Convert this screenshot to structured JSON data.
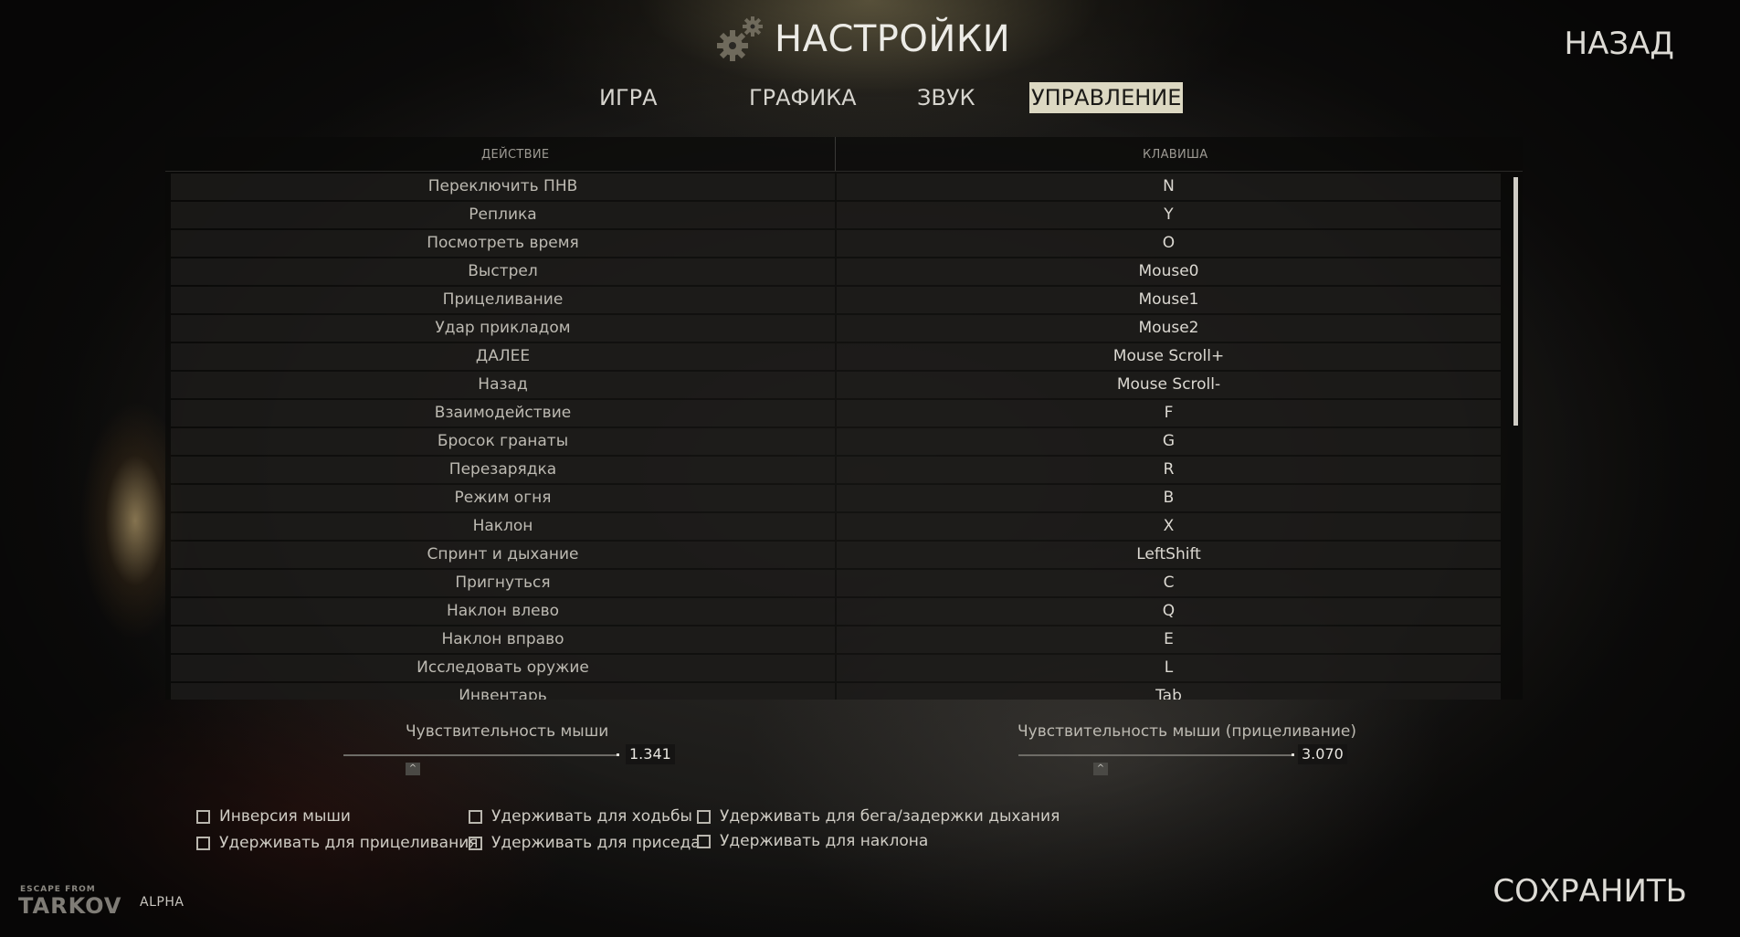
{
  "header": {
    "title": "НАСТРОЙКИ",
    "back_label": "НАЗАД"
  },
  "tabs": [
    {
      "label": "ИГРА",
      "active": false
    },
    {
      "label": "ГРАФИКА",
      "active": false
    },
    {
      "label": "ЗВУК",
      "active": false
    },
    {
      "label": "УПРАВЛЕНИЕ",
      "active": true
    }
  ],
  "table": {
    "columns": [
      "ДЕЙСТВИЕ",
      "КЛАВИША"
    ],
    "rows": [
      {
        "action": "Переключить ПНВ",
        "key": "N"
      },
      {
        "action": "Реплика",
        "key": "Y"
      },
      {
        "action": "Посмотреть время",
        "key": "O"
      },
      {
        "action": "Выстрел",
        "key": "Mouse0"
      },
      {
        "action": "Прицеливание",
        "key": "Mouse1"
      },
      {
        "action": "Удар прикладом",
        "key": "Mouse2"
      },
      {
        "action": "ДАЛЕЕ",
        "key": "Mouse Scroll+"
      },
      {
        "action": "Назад",
        "key": "Mouse Scroll-"
      },
      {
        "action": "Взаимодействие",
        "key": "F"
      },
      {
        "action": "Бросок гранаты",
        "key": "G"
      },
      {
        "action": "Перезарядка",
        "key": "R"
      },
      {
        "action": "Режим огня",
        "key": "B"
      },
      {
        "action": "Наклон",
        "key": "X"
      },
      {
        "action": "Спринт и дыхание",
        "key": "LeftShift"
      },
      {
        "action": "Пригнуться",
        "key": "C"
      },
      {
        "action": "Наклон влево",
        "key": "Q"
      },
      {
        "action": "Наклон вправо",
        "key": "E"
      },
      {
        "action": "Исследовать оружие",
        "key": "L"
      },
      {
        "action": "Инвентарь",
        "key": "Tab"
      }
    ]
  },
  "sliders": {
    "mouse_sensitivity": {
      "label": "Чувствительность мыши",
      "value": "1.341"
    },
    "aim_sensitivity": {
      "label": "Чувствительность мыши (прицеливание)",
      "value": "3.070"
    },
    "handle_glyph": "^"
  },
  "checkboxes": [
    {
      "label": "Инверсия мыши",
      "checked": false
    },
    {
      "label": "Удерживать для прицеливания",
      "checked": false
    },
    {
      "label": "Удерживать для ходьбы",
      "checked": false
    },
    {
      "label": "Удерживать для приседа",
      "checked": false
    },
    {
      "label": "Удерживать для бега/задержки дыхания",
      "checked": false
    },
    {
      "label": "Удерживать для наклона",
      "checked": false
    }
  ],
  "footer": {
    "logo_top": "ESCAPE FROM",
    "logo_main": "TARKOV",
    "alpha_label": "ALPHA",
    "save_label": "СОХРАНИТЬ"
  },
  "icons": {
    "settings": "gear-icon",
    "slider_handle": "caret-up-icon"
  },
  "colors": {
    "active_tab_bg": "#dcd8c2",
    "active_tab_text": "#1b1a17"
  }
}
